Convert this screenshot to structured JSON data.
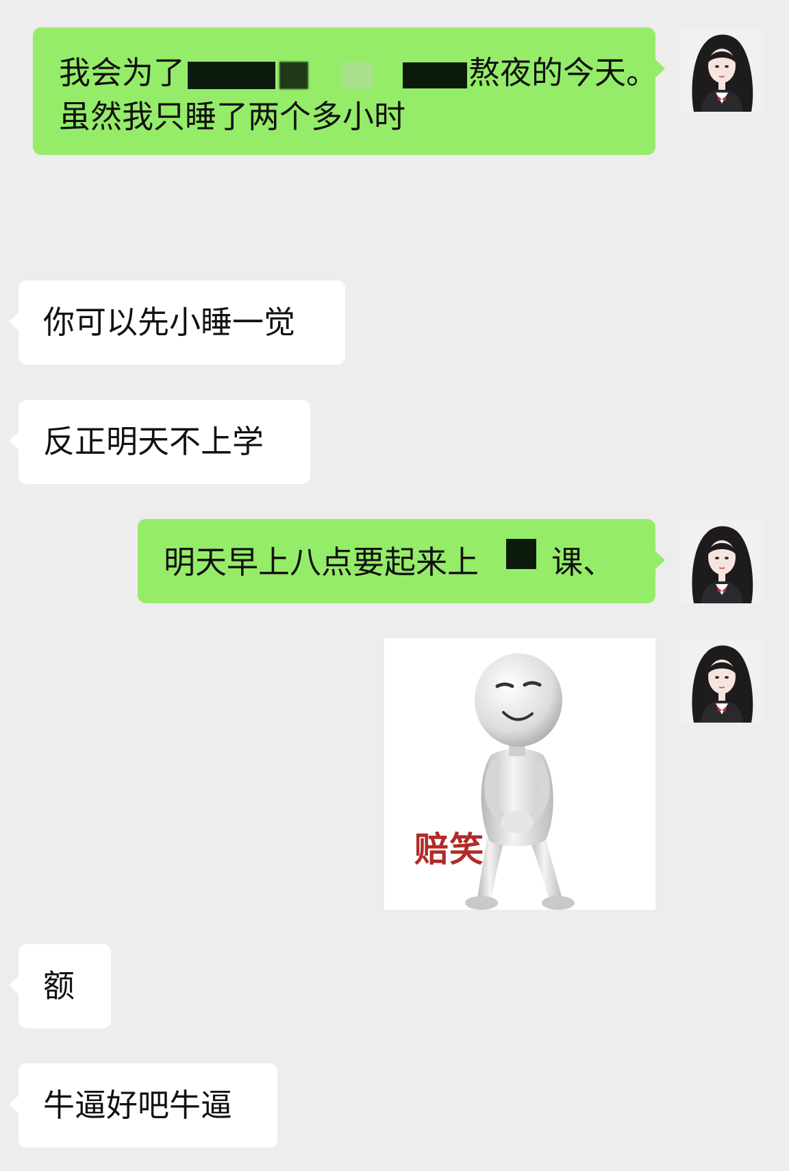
{
  "messages": [
    {
      "sender": "me",
      "line1_before": "我会为了",
      "line1_after": "熬夜的今天。",
      "line2": "虽然我只睡了两个多小时"
    },
    {
      "sender": "them",
      "text": "你可以先小睡一觉"
    },
    {
      "sender": "them",
      "text": "反正明天不上学"
    },
    {
      "sender": "me",
      "text_before": "明天早上八点要起来上",
      "text_after": "课、"
    },
    {
      "sender": "me",
      "type": "sticker",
      "caption": "赔笑"
    },
    {
      "sender": "them",
      "text": "额"
    },
    {
      "sender": "them",
      "text": "牛逼好吧牛逼"
    }
  ],
  "colors": {
    "background": "#ededed",
    "my_bubble": "#95ec69",
    "their_bubble": "#ffffff",
    "redaction": "#0c1a0c",
    "sticker_caption": "#b22a2a"
  },
  "icons": {
    "avatar": "user-avatar-icon"
  }
}
